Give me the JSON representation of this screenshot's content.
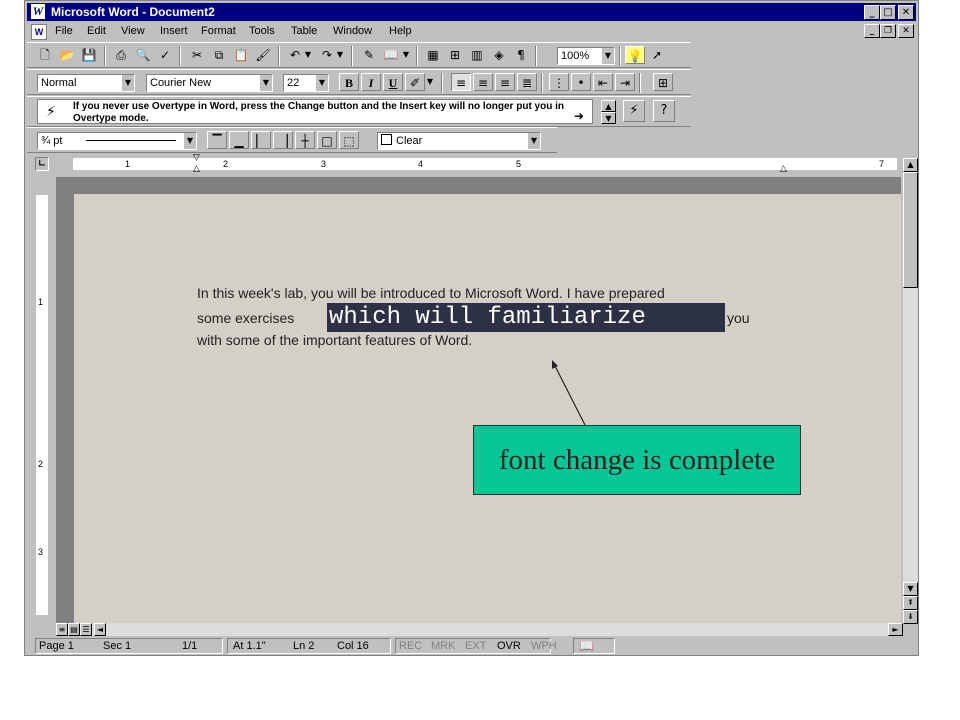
{
  "window": {
    "app_name": "Microsoft Word",
    "title": "Microsoft Word - Document2",
    "app_logo": "W"
  },
  "menu": [
    "File",
    "Edit",
    "View",
    "Insert",
    "Format",
    "Tools",
    "Table",
    "Window",
    "Help"
  ],
  "standard_toolbar": {
    "zoom": "100%"
  },
  "format_toolbar": {
    "style": "Normal",
    "font": "Courier New",
    "size": "22",
    "bold": "B",
    "italic": "I",
    "underline": "U"
  },
  "tip": {
    "text": "If you never use Overtype in Word, press the Change button and the Insert key will no longer put you in Overtype mode."
  },
  "borders_toolbar": {
    "line_weight": "¾ pt",
    "shading": "Clear"
  },
  "ruler": {
    "numbers": [
      "1",
      "2",
      "3",
      "4",
      "5",
      "7"
    ]
  },
  "vruler": {
    "numbers": [
      "1",
      "2",
      "3"
    ]
  },
  "document": {
    "line1": "In this week's lab, you will be introduced to Microsoft Word. I have prepared",
    "line2_before": "some exercises",
    "selected_text": "which will familiarize",
    "line2_after": "you",
    "line3": "with some of the important features of Word."
  },
  "callout": {
    "text": "font change is complete"
  },
  "status": {
    "page": "Page 1",
    "sec": "Sec 1",
    "pages": "1/1",
    "at": "At 1.1\"",
    "ln": "Ln 2",
    "col": "Col 16",
    "rec": "REC",
    "mrk": "MRK",
    "ext": "EXT",
    "ovr": "OVR",
    "wph": "WPH"
  },
  "colors": {
    "title_bar": "#000080",
    "selection": "#2d3146",
    "callout": "#05c796",
    "page": "#d4d0c8"
  }
}
